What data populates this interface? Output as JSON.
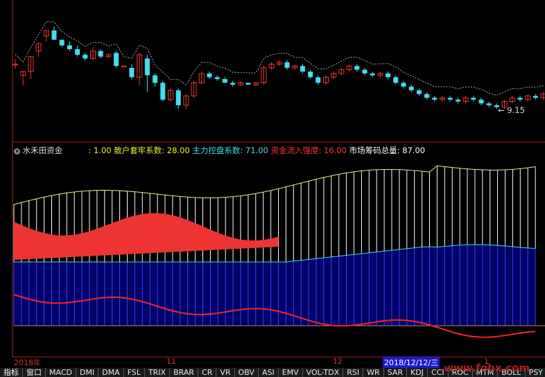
{
  "colors": {
    "up": "#ee3333",
    "down": "#44ddee",
    "ma": "#dddddd",
    "bg": "#000000",
    "label_white": "#dddddd",
    "label_yellow": "#eeee33",
    "label_cyan": "#44ddee",
    "label_red": "#ff3333",
    "blue_fill": "#0000bb",
    "white_bar": "#ffffff"
  },
  "price_panel": {
    "low_marker": "9.15",
    "candles": [
      [
        1,
        0.5,
        0.5,
        0.55,
        0.45
      ],
      [
        2,
        0.38,
        0.42,
        0.27,
        0.42
      ],
      [
        3,
        0.42,
        0.58,
        0.34,
        0.58
      ],
      [
        4,
        0.64,
        0.72,
        0.58,
        0.72
      ],
      [
        5,
        0.8,
        0.86,
        0.74,
        0.86
      ],
      [
        6,
        0.86,
        0.76,
        0.78,
        0.9
      ],
      [
        7,
        0.76,
        0.7,
        0.68,
        0.76
      ],
      [
        8,
        0.7,
        0.66,
        0.64,
        0.74
      ],
      [
        9,
        0.66,
        0.6,
        0.58,
        0.7
      ],
      [
        10,
        0.6,
        0.56,
        0.54,
        0.62
      ],
      [
        11,
        0.56,
        0.64,
        0.54,
        0.68
      ],
      [
        12,
        0.64,
        0.58,
        0.56,
        0.66
      ],
      [
        13,
        0.58,
        0.6,
        0.56,
        0.62
      ],
      [
        14,
        0.62,
        0.48,
        0.46,
        0.64
      ],
      [
        15,
        0.48,
        0.48,
        0.48,
        0.48
      ],
      [
        16,
        0.46,
        0.36,
        0.34,
        0.5
      ],
      [
        17,
        0.36,
        0.6,
        0.28,
        0.62
      ],
      [
        18,
        0.56,
        0.38,
        0.2,
        0.6
      ],
      [
        19,
        0.38,
        0.3,
        0.26,
        0.4
      ],
      [
        20,
        0.3,
        0.12,
        0.1,
        0.32
      ],
      [
        21,
        0.12,
        0.22,
        0.1,
        0.24
      ],
      [
        22,
        0.22,
        0.06,
        0.02,
        0.24
      ],
      [
        23,
        0.06,
        0.16,
        0.02,
        0.18
      ],
      [
        24,
        0.16,
        0.3,
        0.14,
        0.32
      ],
      [
        25,
        0.3,
        0.4,
        0.28,
        0.42
      ],
      [
        26,
        0.4,
        0.36,
        0.34,
        0.42
      ],
      [
        27,
        0.36,
        0.34,
        0.32,
        0.38
      ],
      [
        28,
        0.34,
        0.3,
        0.3,
        0.36
      ],
      [
        29,
        0.3,
        0.28,
        0.26,
        0.32
      ],
      [
        30,
        0.28,
        0.3,
        0.26,
        0.32
      ],
      [
        31,
        0.3,
        0.28,
        0.28,
        0.3
      ],
      [
        32,
        0.28,
        0.3,
        0.26,
        0.3
      ],
      [
        33,
        0.3,
        0.46,
        0.28,
        0.48
      ],
      [
        34,
        0.46,
        0.5,
        0.44,
        0.52
      ],
      [
        35,
        0.5,
        0.52,
        0.48,
        0.54
      ],
      [
        36,
        0.52,
        0.46,
        0.44,
        0.54
      ],
      [
        37,
        0.46,
        0.48,
        0.44,
        0.5
      ],
      [
        38,
        0.48,
        0.42,
        0.4,
        0.5
      ],
      [
        39,
        0.42,
        0.36,
        0.34,
        0.44
      ],
      [
        40,
        0.36,
        0.3,
        0.28,
        0.38
      ],
      [
        41,
        0.3,
        0.36,
        0.28,
        0.38
      ],
      [
        42,
        0.36,
        0.4,
        0.34,
        0.42
      ],
      [
        43,
        0.4,
        0.44,
        0.38,
        0.46
      ],
      [
        44,
        0.44,
        0.48,
        0.42,
        0.5
      ],
      [
        45,
        0.48,
        0.44,
        0.42,
        0.5
      ],
      [
        46,
        0.44,
        0.4,
        0.38,
        0.46
      ],
      [
        47,
        0.4,
        0.38,
        0.36,
        0.42
      ],
      [
        48,
        0.38,
        0.4,
        0.36,
        0.42
      ],
      [
        49,
        0.4,
        0.36,
        0.34,
        0.42
      ],
      [
        50,
        0.36,
        0.3,
        0.28,
        0.38
      ],
      [
        51,
        0.3,
        0.26,
        0.24,
        0.32
      ],
      [
        52,
        0.26,
        0.22,
        0.2,
        0.28
      ],
      [
        53,
        0.22,
        0.18,
        0.16,
        0.24
      ],
      [
        54,
        0.18,
        0.14,
        0.12,
        0.2
      ],
      [
        55,
        0.14,
        0.12,
        0.1,
        0.16
      ],
      [
        56,
        0.12,
        0.14,
        0.1,
        0.16
      ],
      [
        57,
        0.14,
        0.12,
        0.1,
        0.16
      ],
      [
        58,
        0.12,
        0.1,
        0.08,
        0.14
      ],
      [
        59,
        0.1,
        0.14,
        0.08,
        0.16
      ],
      [
        60,
        0.14,
        0.12,
        0.1,
        0.16
      ],
      [
        61,
        0.12,
        0.08,
        0.06,
        0.14
      ],
      [
        62,
        0.08,
        0.06,
        0.04,
        0.1
      ],
      [
        63,
        0.06,
        0.04,
        0.02,
        0.08
      ],
      [
        64,
        0.04,
        0.1,
        0.02,
        0.12
      ],
      [
        65,
        0.1,
        0.14,
        0.08,
        0.16
      ],
      [
        66,
        0.14,
        0.12,
        0.1,
        0.16
      ],
      [
        67,
        0.12,
        0.16,
        0.1,
        0.18
      ],
      [
        68,
        0.16,
        0.14,
        0.12,
        0.18
      ],
      [
        69,
        0.14,
        0.18,
        0.12,
        0.2
      ]
    ]
  },
  "indicator_header": {
    "name": "水禾田资金",
    "v1": ": 1.00",
    "retail_label": "散户套牢系数:",
    "retail_value": "28.00",
    "main_label": "主力控盘系数:",
    "main_value": "71.00",
    "inflow_label": "资金流入强度:",
    "inflow_value": "16.00",
    "total_label": "市场筹码总量:",
    "total_value": "87.00"
  },
  "date_axis": {
    "labels": [
      "2018年",
      "11",
      "12",
      "2018/12/12/三",
      "1"
    ]
  },
  "tabs": [
    "指标",
    "窗口",
    "MACD",
    "DMI",
    "DMA",
    "FSL",
    "TRIX",
    "BRAR",
    "CR",
    "VR",
    "OBV",
    "ASI",
    "EMV",
    "VOL-TDX",
    "RSI",
    "WR",
    "SAR",
    "KDJ",
    "CCI",
    "ROC",
    "MTM",
    "BOLL",
    "PSY"
  ],
  "watermark": "www.fobx.com"
}
